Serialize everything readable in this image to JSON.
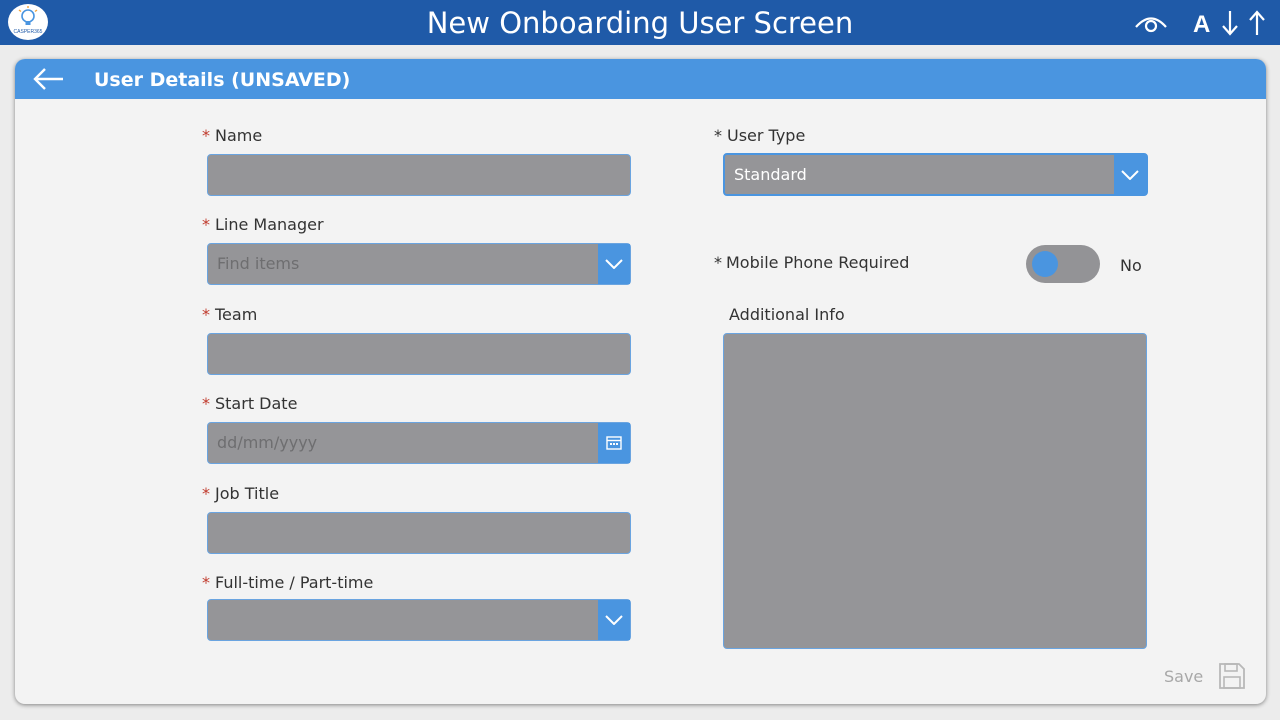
{
  "app": {
    "title": "New Onboarding User Screen",
    "logo_text": "CASPER365",
    "font_size_letter": "A"
  },
  "card": {
    "title": "User Details (UNSAVED)"
  },
  "form": {
    "name": {
      "label": "Name",
      "value": ""
    },
    "line_manager": {
      "label": "Line Manager",
      "placeholder": "Find items"
    },
    "team": {
      "label": "Team",
      "value": ""
    },
    "start_date": {
      "label": "Start Date",
      "placeholder": "dd/mm/yyyy"
    },
    "job_title": {
      "label": "Job Title",
      "value": ""
    },
    "employment": {
      "label": "Full-time / Part-time",
      "value": ""
    },
    "user_type": {
      "label": "User Type",
      "value": "Standard"
    },
    "mobile_phone": {
      "label": "Mobile Phone Required",
      "value": "No"
    },
    "additional_info": {
      "label": "Additional Info",
      "value": ""
    },
    "required_marker": "*"
  },
  "actions": {
    "save_label": "Save"
  },
  "colors": {
    "topbar": "#1f5aa8",
    "accent": "#4a95e0",
    "field_bg": "#959598",
    "required": "#c0392b"
  }
}
